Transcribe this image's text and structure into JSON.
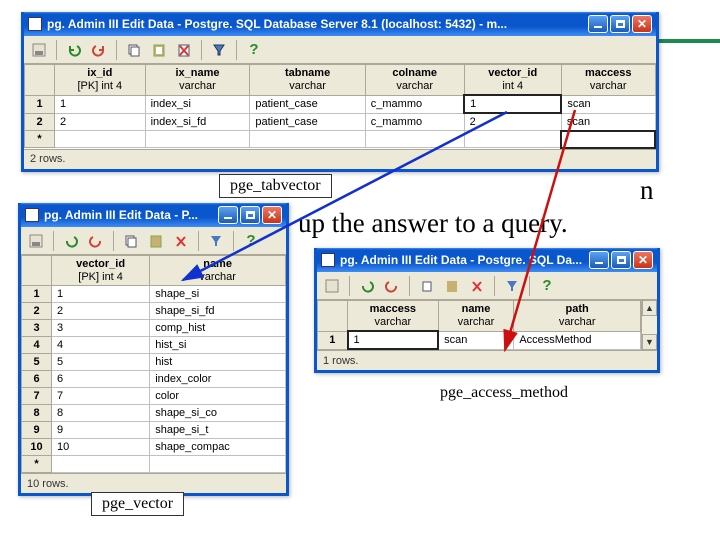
{
  "bg_text_1": "n",
  "bg_text_2": "up the answer to a query.",
  "labels": {
    "tabvector": "pge_tabvector",
    "vector": "pge_vector",
    "access": "pge_access_method"
  },
  "win1": {
    "title": "pg. Admin III Edit Data - Postgre. SQL Database Server 8.1 (localhost: 5432) - m...",
    "status": "2 rows.",
    "cols": [
      {
        "h": "ix_id",
        "s": "[PK] int 4"
      },
      {
        "h": "ix_name",
        "s": "varchar"
      },
      {
        "h": "tabname",
        "s": "varchar"
      },
      {
        "h": "colname",
        "s": "varchar"
      },
      {
        "h": "vector_id",
        "s": "int 4"
      },
      {
        "h": "maccess",
        "s": "varchar"
      }
    ],
    "rows": [
      {
        "n": "1",
        "c": [
          "1",
          "index_si",
          "patient_case",
          "c_mammo",
          "1",
          "scan"
        ]
      },
      {
        "n": "2",
        "c": [
          "2",
          "index_si_fd",
          "patient_case",
          "c_mammo",
          "2",
          "scan"
        ]
      },
      {
        "n": "*",
        "c": [
          "",
          "",
          "",
          "",
          "",
          ""
        ]
      }
    ]
  },
  "win2": {
    "title": "pg. Admin III Edit Data - P...",
    "status": "10 rows.",
    "cols": [
      {
        "h": "vector_id",
        "s": "[PK] int 4"
      },
      {
        "h": "name",
        "s": "varchar"
      }
    ],
    "rows": [
      {
        "n": "1",
        "c": [
          "1",
          "shape_si"
        ]
      },
      {
        "n": "2",
        "c": [
          "2",
          "shape_si_fd"
        ]
      },
      {
        "n": "3",
        "c": [
          "3",
          "comp_hist"
        ]
      },
      {
        "n": "4",
        "c": [
          "4",
          "hist_si"
        ]
      },
      {
        "n": "5",
        "c": [
          "5",
          "hist"
        ]
      },
      {
        "n": "6",
        "c": [
          "6",
          "index_color"
        ]
      },
      {
        "n": "7",
        "c": [
          "7",
          "color"
        ]
      },
      {
        "n": "8",
        "c": [
          "8",
          "shape_si_co"
        ]
      },
      {
        "n": "9",
        "c": [
          "9",
          "shape_si_t"
        ]
      },
      {
        "n": "10",
        "c": [
          "10",
          "shape_compac"
        ]
      },
      {
        "n": "*",
        "c": [
          "",
          ""
        ]
      }
    ]
  },
  "win3": {
    "title": "pg. Admin III Edit Data - Postgre. SQL Da...",
    "status": "1 rows.",
    "cols": [
      {
        "h": "maccess",
        "s": "varchar"
      },
      {
        "h": "name",
        "s": "varchar"
      },
      {
        "h": "path",
        "s": "varchar"
      }
    ],
    "rows": [
      {
        "n": "1",
        "c": [
          "1",
          "scan",
          "AccessMethod"
        ]
      }
    ]
  }
}
